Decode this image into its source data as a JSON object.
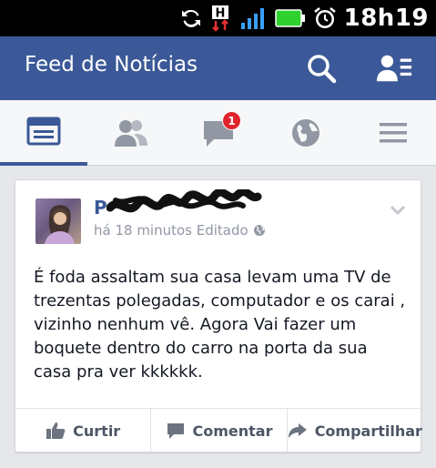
{
  "status_bar": {
    "time": "18h19",
    "icons": [
      "sync-icon",
      "hplus-data-icon",
      "signal-icon",
      "battery-icon",
      "alarm-icon"
    ]
  },
  "header": {
    "title": "Feed de Notícias",
    "buttons": [
      "search-icon",
      "friend-requests-icon"
    ]
  },
  "tabs": [
    {
      "name": "news-feed-icon",
      "active": true
    },
    {
      "name": "friends-icon",
      "active": false
    },
    {
      "name": "messages-icon",
      "active": false,
      "badge": "1"
    },
    {
      "name": "notifications-globe-icon",
      "active": false
    },
    {
      "name": "menu-icon",
      "active": false
    }
  ],
  "post": {
    "author_initial": "P",
    "timestamp": "há 18 minutos Editado",
    "text": "É foda assaltam sua casa levam uma TV de trezentas polegadas, computador e os carai , vizinho nenhum vê.  Agora Vai fazer um boquete dentro do carro na porta da sua casa pra ver kkkkkk.",
    "actions": {
      "like": "Curtir",
      "comment": "Comentar",
      "share": "Compartilhar"
    }
  },
  "colors": {
    "brand_blue": "#3b5998",
    "badge_red": "#e0242b"
  }
}
